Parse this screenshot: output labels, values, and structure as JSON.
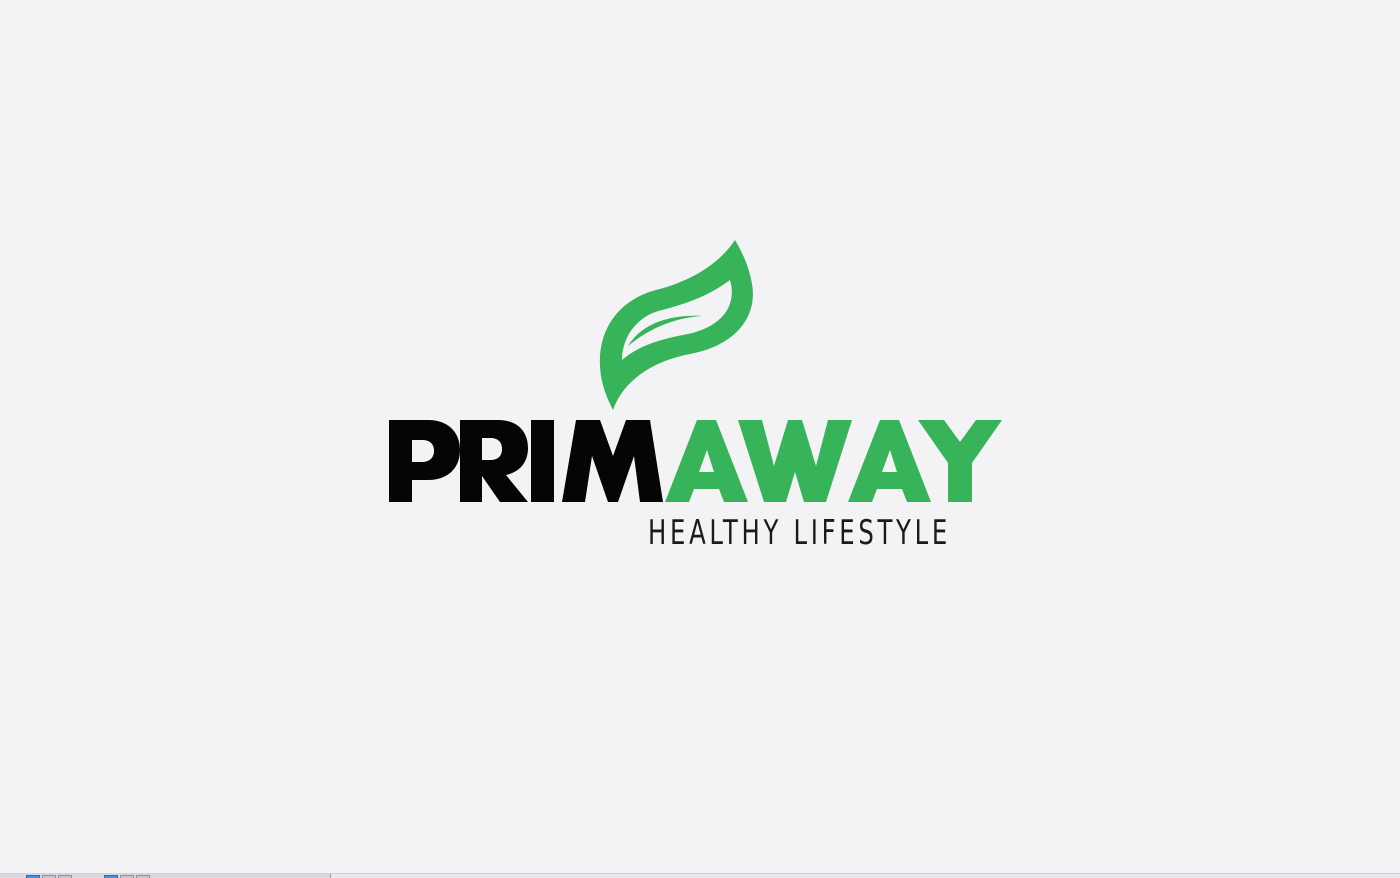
{
  "logo": {
    "brand_primary": "PRIM",
    "brand_secondary": "AWAY",
    "tagline": "HEALTHY LIFESTYLE",
    "icon": "leaf-icon"
  },
  "colors": {
    "background": "#f3f3f5",
    "brand_dark": "#050505",
    "brand_green": "#37b35a",
    "tagline_color": "#1a1a1a"
  }
}
